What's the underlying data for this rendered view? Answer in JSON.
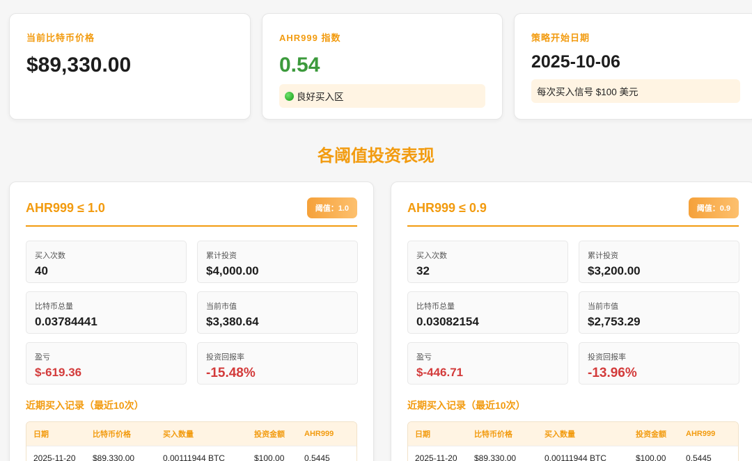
{
  "cards": {
    "btc_price": {
      "label": "当前比特币价格",
      "value": "$89,330.00"
    },
    "ahr_index": {
      "label": "AHR999 指数",
      "value": "0.54",
      "note": "良好买入区"
    },
    "start_date": {
      "label": "策略开始日期",
      "value": "2025-10-06",
      "note": "每次买入信号 $100 美元"
    }
  },
  "section_title": "各阈值投资表现",
  "panels": [
    {
      "title": "AHR999 ≤ 1.0",
      "badge": "阈值：1.0",
      "stats": {
        "buy_count": {
          "label": "买入次数",
          "value": "40"
        },
        "total_invest": {
          "label": "累计投资",
          "value": "$4,000.00"
        },
        "btc_total": {
          "label": "比特币总量",
          "value": "0.03784441"
        },
        "market_value": {
          "label": "当前市值",
          "value": "$3,380.64"
        },
        "pnl": {
          "label": "盈亏",
          "value": "$-619.36"
        },
        "roi": {
          "label": "投资回报率",
          "value": "-15.48%"
        }
      },
      "records_title": "近期买入记录（最近10次）",
      "table": {
        "headers": [
          "日期",
          "比特币价格",
          "买入数量",
          "投资金额",
          "AHR999"
        ],
        "rows": [
          [
            "2025-11-20",
            "$89,330.00",
            "0.00111944 BTC",
            "$100.00",
            "0.5445"
          ]
        ]
      }
    },
    {
      "title": "AHR999 ≤ 0.9",
      "badge": "阈值：0.9",
      "stats": {
        "buy_count": {
          "label": "买入次数",
          "value": "32"
        },
        "total_invest": {
          "label": "累计投资",
          "value": "$3,200.00"
        },
        "btc_total": {
          "label": "比特币总量",
          "value": "0.03082154"
        },
        "market_value": {
          "label": "当前市值",
          "value": "$2,753.29"
        },
        "pnl": {
          "label": "盈亏",
          "value": "$-446.71"
        },
        "roi": {
          "label": "投资回报率",
          "value": "-13.96%"
        }
      },
      "records_title": "近期买入记录（最近10次）",
      "table": {
        "headers": [
          "日期",
          "比特币价格",
          "买入数量",
          "投资金额",
          "AHR999"
        ],
        "rows": [
          [
            "2025-11-20",
            "$89,330.00",
            "0.00111944 BTC",
            "$100.00",
            "0.5445"
          ]
        ]
      }
    }
  ]
}
